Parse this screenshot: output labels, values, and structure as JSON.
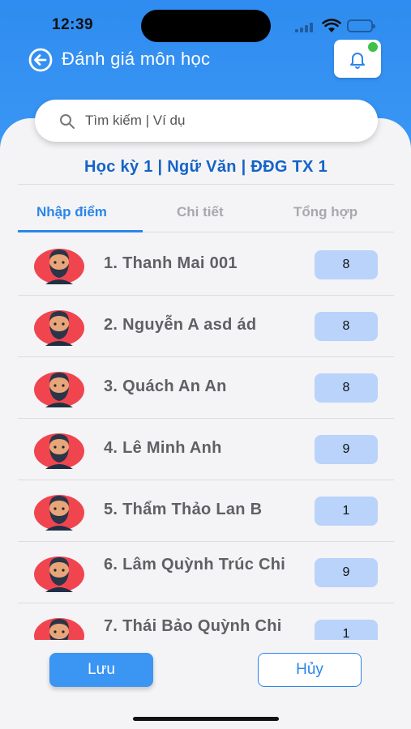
{
  "status": {
    "time": "12:39"
  },
  "header": {
    "title": "Đánh giá môn học",
    "back_icon": "back-arrow-icon",
    "bell_icon": "bell-icon"
  },
  "search": {
    "placeholder": "Tìm kiếm | Ví dụ",
    "value": ""
  },
  "subject_line": "Học kỳ 1 | Ngữ Văn | ĐĐG TX 1",
  "tabs": [
    {
      "label": "Nhập điểm",
      "active": true
    },
    {
      "label": "Chi tiết",
      "active": false
    },
    {
      "label": "Tổng hợp",
      "active": false
    }
  ],
  "students": [
    {
      "name": "1. Thanh Mai 001",
      "score": "8"
    },
    {
      "name": "2. Nguyễn A asd ád",
      "score": "8"
    },
    {
      "name": "3. Quách An An",
      "score": "8"
    },
    {
      "name": "4. Lê Minh Anh",
      "score": "9"
    },
    {
      "name": "5. Thẩm Thảo Lan B",
      "score": "1"
    },
    {
      "name": "6. Lâm Quỳnh Trúc Chi",
      "score": "9"
    },
    {
      "name": "7. Thái Bảo Quỳnh Chi",
      "score": "1"
    }
  ],
  "actions": {
    "save_label": "Lưu",
    "cancel_label": "Hủy"
  },
  "colors": {
    "primary": "#2a86ea",
    "score_bg": "#b9d3fb",
    "notification_dot": "#3fc14b",
    "avatar_bg": "#f0454f"
  }
}
